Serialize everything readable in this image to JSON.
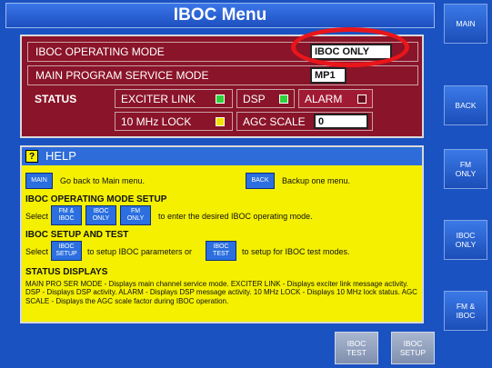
{
  "title": "IBOC Menu",
  "mode_panel": {
    "operating_mode_label": "IBOC OPERATING MODE",
    "operating_mode_value": "IBOC ONLY",
    "service_mode_label": "MAIN PROGRAM SERVICE MODE",
    "service_mode_value": "MP1",
    "status_label": "STATUS",
    "exciter_link_label": "EXCITER LINK",
    "dsp_label": "DSP",
    "alarm_label": "ALARM",
    "lock_label": "10 MHz LOCK",
    "agc_label": "AGC SCALE",
    "agc_value": "0",
    "colors": {
      "exciter_led": "#2fd13a",
      "dsp_led": "#2fd13a",
      "alarm_led": "#6b0f1e",
      "lock_led": "#f2e000"
    }
  },
  "help": {
    "title": "HELP",
    "main_btn": "MAIN",
    "main_text": "Go back to Main menu.",
    "back_btn": "BACK",
    "back_text": "Backup one menu.",
    "op_mode_heading": "IBOC OPERATING MODE SETUP",
    "select_label": "Select",
    "fm_iboc_btn": "FM &\nIBOC",
    "iboc_only_btn": "IBOC\nONLY",
    "fm_only_btn": "FM\nONLY",
    "op_mode_text": "to enter the desired IBOC operating mode.",
    "setup_heading": "IBOC SETUP AND TEST",
    "select_label2": "Select",
    "iboc_setup_btn": "IBOC\nSETUP",
    "setup_text": "to setup IBOC parameters or",
    "iboc_test_btn": "IBOC\nTEST",
    "test_text": "to setup for IBOC test modes.",
    "status_heading": "STATUS DISPLAYS",
    "status_text": "MAIN PRO SER MODE - Displays main channel service mode.  EXCITER LINK - Displays exciter link message activity.  DSP - Displays DSP activity.  ALARM - Displays DSP message activity. 10 MHz LOCK - Displays 10 MHz lock status. AGC SCALE - Displays the AGC scale factor during IBOC operation."
  },
  "side_buttons": [
    "MAIN",
    "BACK",
    "FM\nONLY",
    "IBOC\nONLY",
    "FM &\nIBOC"
  ],
  "bottom_buttons": [
    "IBOC\nTEST",
    "IBOC\nSETUP"
  ]
}
